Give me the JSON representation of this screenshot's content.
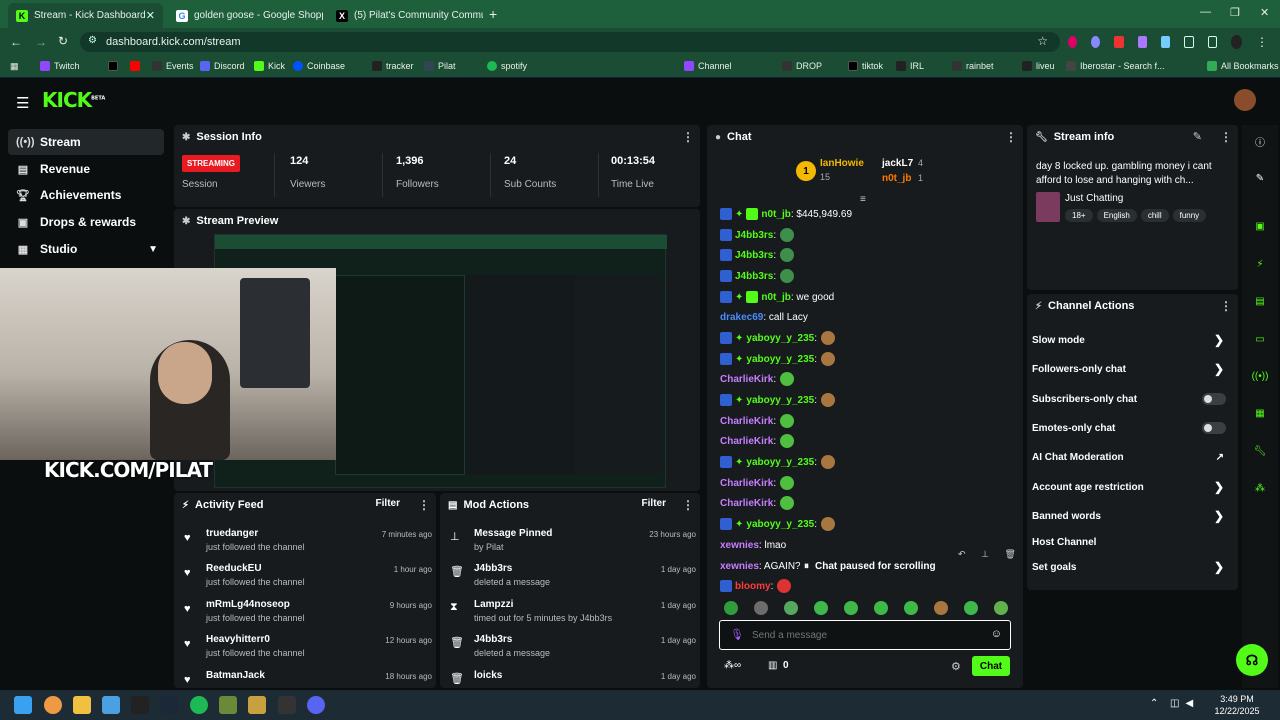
{
  "browser": {
    "tabs": [
      {
        "title": "Stream - Kick Dashboard",
        "fav": "K"
      },
      {
        "title": "golden goose - Google Shoppin",
        "fav": "G"
      },
      {
        "title": "(5) Pilat's Community Commun",
        "fav": "X"
      }
    ],
    "url": "dashboard.kick.com/stream",
    "bookmarks": [
      "Twitch",
      "Events",
      "Discord",
      "Kick",
      "Coinbase",
      "tracker",
      "Pilat",
      "spotify",
      "Channel",
      "DROP",
      "tiktok",
      "IRL",
      "rainbet",
      "liveu",
      "Iberostar - Search f...",
      "All Bookmarks"
    ]
  },
  "app": {
    "logo": "KICK",
    "logo_beta": "BETA",
    "accent": "#53fc18",
    "sidebar": {
      "items": [
        {
          "label": "Stream",
          "icon": "broadcast-icon"
        },
        {
          "label": "Revenue",
          "icon": "revenue-icon"
        },
        {
          "label": "Achievements",
          "icon": "trophy-icon"
        },
        {
          "label": "Drops & rewards",
          "icon": "gift-icon"
        },
        {
          "label": "Studio",
          "icon": "studio-icon"
        }
      ]
    },
    "session": {
      "title": "Session Info",
      "status": "STREAMING",
      "status_label": "Session",
      "viewers": "124",
      "viewers_label": "Viewers",
      "followers": "1,396",
      "followers_label": "Followers",
      "subs": "24",
      "subs_label": "Sub Counts",
      "time": "00:13:54",
      "time_label": "Time Live"
    },
    "preview": {
      "title": "Stream Preview",
      "overlay": "KICK.COM/PILAT"
    },
    "activity": {
      "title": "Activity Feed",
      "filter": "Filter",
      "rows": [
        {
          "name": "truedanger",
          "sub": "just followed the channel",
          "time": "7 minutes ago"
        },
        {
          "name": "ReeduckEU",
          "sub": "just followed the channel",
          "time": "1 hour ago"
        },
        {
          "name": "mRmLg44noseop",
          "sub": "just followed the channel",
          "time": "9 hours ago"
        },
        {
          "name": "Heavyhitterr0",
          "sub": "just followed the channel",
          "time": "12 hours ago"
        },
        {
          "name": "BatmanJack",
          "sub": "",
          "time": "18 hours ago"
        }
      ]
    },
    "mod": {
      "title": "Mod Actions",
      "filter": "Filter",
      "rows": [
        {
          "name": "Message Pinned",
          "sub": "by Pilat",
          "time": "23 hours ago",
          "icon": "pin-icon"
        },
        {
          "name": "J4bb3rs",
          "sub": "deleted a message",
          "time": "1 day ago",
          "icon": "trash-icon"
        },
        {
          "name": "Lampzzi",
          "sub": "timed out for 5 minutes by J4bb3rs",
          "time": "1 day ago",
          "icon": "hourglass-icon"
        },
        {
          "name": "J4bb3rs",
          "sub": "deleted a message",
          "time": "1 day ago",
          "icon": "trash-icon"
        },
        {
          "name": "loicks",
          "sub": "",
          "time": "1 day ago",
          "icon": "trash-icon"
        }
      ]
    },
    "chat": {
      "title": "Chat",
      "leaders": [
        {
          "rank": "1",
          "name": "IanHowie",
          "count": "15"
        },
        {
          "name": "jackL7",
          "count": "4"
        },
        {
          "name": "n0t_jb",
          "count": "1"
        }
      ],
      "messages": [
        {
          "user": "n0t_jb",
          "text": ": $445,949.69",
          "color": "#53fc18"
        },
        {
          "user": "J4bb3rs",
          "text": ":",
          "color": "#53fc18"
        },
        {
          "user": "J4bb3rs",
          "text": ":",
          "color": "#53fc18"
        },
        {
          "user": "J4bb3rs",
          "text": ":",
          "color": "#53fc18"
        },
        {
          "user": "n0t_jb",
          "text": ": we good",
          "color": "#53fc18"
        },
        {
          "user": "drakec69",
          "text": ": call Lacy",
          "color": "#4a8cff"
        },
        {
          "user": "yaboyy_y_235",
          "text": ":",
          "color": "#53fc18"
        },
        {
          "user": "yaboyy_y_235",
          "text": ":",
          "color": "#53fc18"
        },
        {
          "user": "CharlieKirk",
          "text": ":",
          "color": "#c77dff"
        },
        {
          "user": "yaboyy_y_235",
          "text": ":",
          "color": "#53fc18"
        },
        {
          "user": "CharlieKirk",
          "text": ":",
          "color": "#c77dff"
        },
        {
          "user": "CharlieKirk",
          "text": ":",
          "color": "#c77dff"
        },
        {
          "user": "yaboyy_y_235",
          "text": ":",
          "color": "#53fc18"
        },
        {
          "user": "CharlieKirk",
          "text": ":",
          "color": "#c77dff"
        },
        {
          "user": "CharlieKirk",
          "text": ":",
          "color": "#c77dff"
        },
        {
          "user": "yaboyy_y_235",
          "text": ":",
          "color": "#53fc18"
        },
        {
          "user": "xewnies",
          "text": ": lmao",
          "color": "#c77dff"
        },
        {
          "user": "xewnies",
          "text": ": AGAIN?",
          "color": "#c77dff"
        },
        {
          "user": "bloomy",
          "text": ":",
          "color": "#ff3b3b"
        }
      ],
      "paused": "Chat paused for scrolling",
      "placeholder": "Send a message",
      "points": "0",
      "send": "Chat"
    },
    "stream_info": {
      "title": "Stream info",
      "headline": "day 8 locked up. gambling money i cant afford to lose and hanging with ch...",
      "category": "Just Chatting",
      "tags": [
        "18+",
        "English",
        "chill",
        "funny"
      ]
    },
    "channel_actions": {
      "title": "Channel Actions",
      "items": [
        {
          "label": "Slow mode",
          "kind": "chevron"
        },
        {
          "label": "Followers-only chat",
          "kind": "chevron"
        },
        {
          "label": "Subscribers-only chat",
          "kind": "toggle"
        },
        {
          "label": "Emotes-only chat",
          "kind": "toggle"
        },
        {
          "label": "AI Chat Moderation",
          "kind": "external"
        },
        {
          "label": "Account age restriction",
          "kind": "chevron"
        },
        {
          "label": "Banned words",
          "kind": "chevron"
        },
        {
          "label": "Host Channel",
          "kind": "none"
        },
        {
          "label": "Set goals",
          "kind": "chevron"
        }
      ]
    }
  },
  "taskbar": {
    "time": "3:49 PM",
    "date": "12/22/2025"
  }
}
